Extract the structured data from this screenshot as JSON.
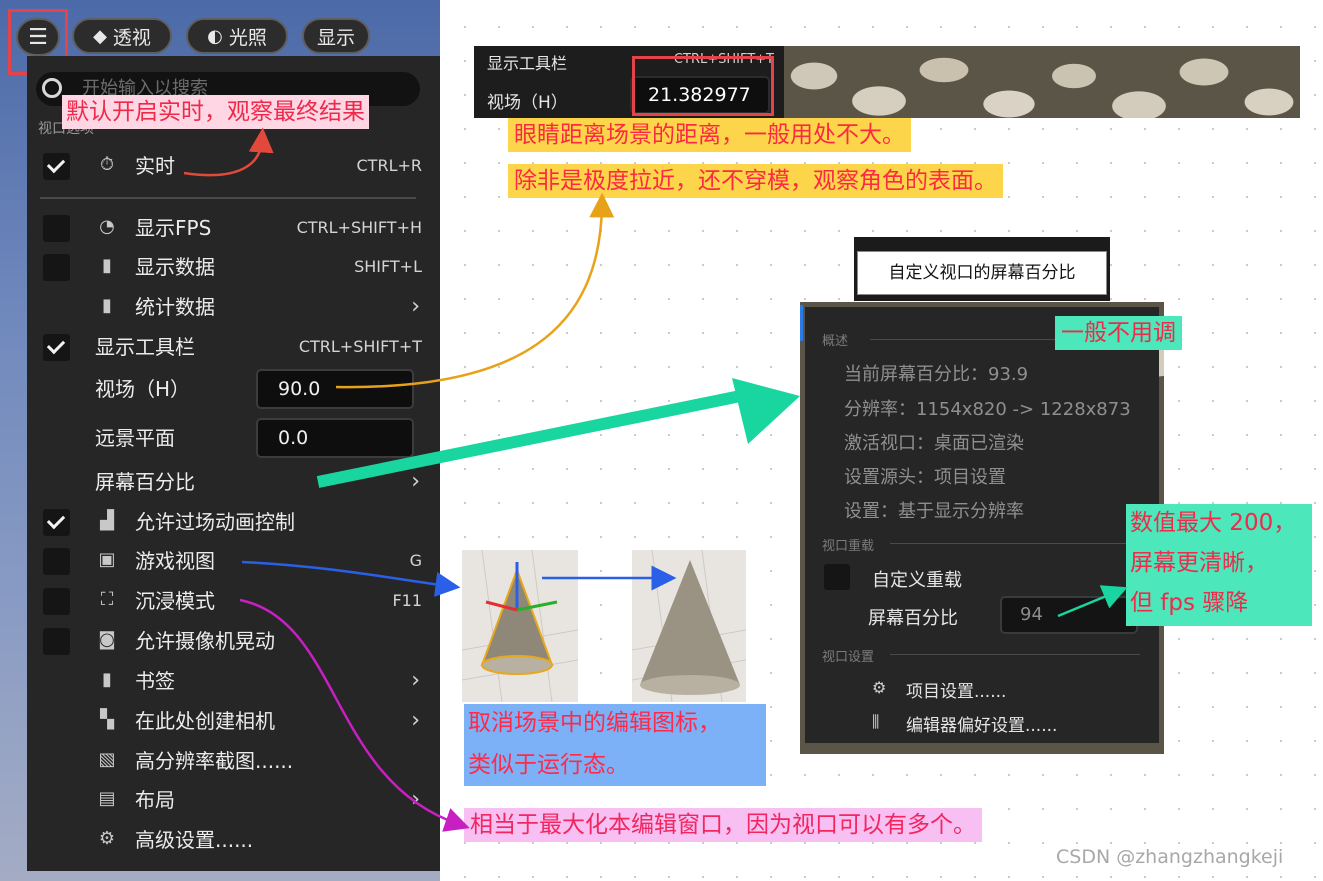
{
  "toolbar": {
    "menu_icon": "hamburger-icon",
    "perspective_label": "透视",
    "lighting_label": "光照",
    "show_label": "显示"
  },
  "search": {
    "placeholder": "开始输入以搜索"
  },
  "menu": {
    "section_label": "视口选项",
    "items": [
      {
        "label": "实时",
        "shortcut": "CTRL+R",
        "checked": true,
        "icon": "stopwatch-icon"
      },
      {
        "label": "显示FPS",
        "shortcut": "CTRL+SHIFT+H",
        "checked": false,
        "icon": "gauge-icon"
      },
      {
        "label": "显示数据",
        "shortcut": "SHIFT+L",
        "checked": false,
        "icon": "bar-chart-icon"
      },
      {
        "label": "统计数据",
        "shortcut": "",
        "icon": "bar-chart-icon",
        "submenu": true
      },
      {
        "label": "显示工具栏",
        "shortcut": "CTRL+SHIFT+T",
        "checked": true
      },
      {
        "label": "视场（H）",
        "value": "90.0"
      },
      {
        "label": "远景平面",
        "value": "0.0"
      },
      {
        "label": "屏幕百分比",
        "submenu": true
      },
      {
        "label": "允许过场动画控制",
        "checked": true,
        "icon": "clapperboard-icon"
      },
      {
        "label": "游戏视图",
        "shortcut": "G",
        "checked": false,
        "icon": "gamepad-icon"
      },
      {
        "label": "沉浸模式",
        "shortcut": "F11",
        "checked": false,
        "icon": "fullscreen-icon"
      },
      {
        "label": "允许摄像机晃动",
        "checked": false,
        "icon": "camera-shake-icon"
      },
      {
        "label": "书签",
        "icon": "bookmark-icon",
        "submenu": true
      },
      {
        "label": "在此处创建相机",
        "icon": "add-camera-icon",
        "submenu": true
      },
      {
        "label": "高分辨率截图......",
        "icon": "screenshot-icon"
      },
      {
        "label": "布局",
        "icon": "layout-icon",
        "submenu": true
      },
      {
        "label": "高级设置......",
        "icon": "gear-icon"
      }
    ]
  },
  "top_panel": {
    "toolbar_label": "显示工具栏",
    "toolbar_shortcut": "CTRL+SHIFT+T",
    "fov_label": "视场（H）",
    "fov_value": "21.382977"
  },
  "tooltip": {
    "text": "自定义视口的屏幕百分比"
  },
  "screen_pct_panel": {
    "overview_label": "概述",
    "current": "当前屏幕百分比：93.9",
    "resolution": "分辨率：1154x820 -> 1228x873",
    "active_viewport": "激活视口：桌面已渲染",
    "source": "设置源头：项目设置",
    "setting": "设置：基于显示分辨率",
    "override_label": "视口重载",
    "custom_override": "自定义重载",
    "screen_pct_label": "屏幕百分比",
    "screen_pct_value": "94",
    "viewport_settings_label": "视口设置",
    "project_settings": "项目设置......",
    "editor_prefs": "编辑器偏好设置......"
  },
  "annotations": {
    "realtime": "默认开启实时，观察最终结果",
    "fov_line1": "眼睛距离场景的距离，一般用处不大。",
    "fov_line2": "除非是极度拉近，还不穿模，观察角色的表面。",
    "no_adjust": "一般不用调",
    "max_line1": "数值最大 200，",
    "max_line2": "屏幕更清晰，",
    "max_line3": "但 fps 骤降",
    "game_view_line1": "取消场景中的编辑图标，",
    "game_view_line2": "类似于运行态。",
    "immersive": "相当于最大化本编辑窗口，因为视口可以有多个。"
  },
  "watermark": "CSDN @zhangzhangkeji",
  "colors": {
    "arrow_red": "#e2483c",
    "arrow_orange": "#e8a21a",
    "arrow_green": "#19d6a0",
    "arrow_blue": "#2a5fe8",
    "arrow_magenta": "#c81fc3",
    "highlight_red": "#e6424a"
  }
}
